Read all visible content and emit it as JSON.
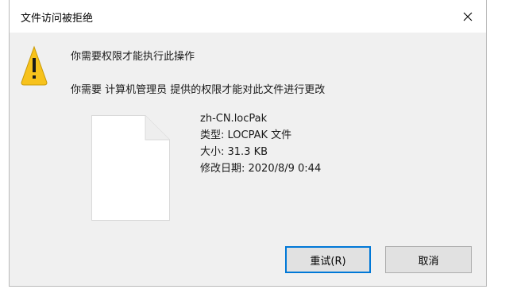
{
  "window": {
    "title": "文件访问被拒绝",
    "close_icon": "close-icon"
  },
  "message": {
    "icon": "warning-icon",
    "heading": "你需要权限才能执行此操作",
    "detail": "你需要 计算机管理员 提供的权限才能对此文件进行更改"
  },
  "file": {
    "icon": "file-icon",
    "name": "zh-CN.locPak",
    "type_line": "类型: LOCPAK 文件",
    "size_line": "大小: 31.3 KB",
    "modified_line": "修改日期: 2020/8/9 0:44"
  },
  "buttons": {
    "retry_label": "重试(R)",
    "cancel_label": "取消"
  },
  "colors": {
    "accent": "#0078d7",
    "warning": "#f7c21c",
    "dialog_bg": "#f0f0f0"
  }
}
